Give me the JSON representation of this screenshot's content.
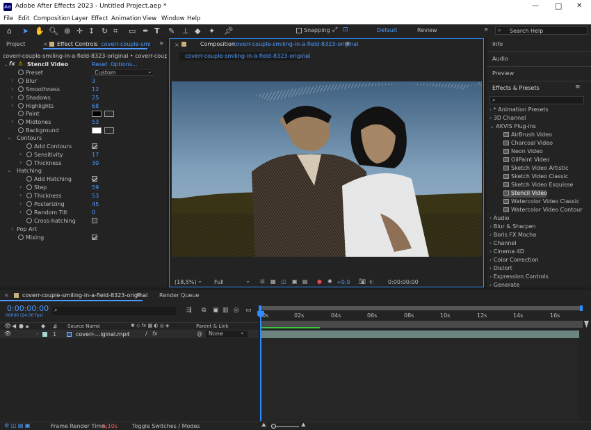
{
  "app": {
    "title": "Adobe After Effects 2023 - Untitled Project.aep *",
    "logo": "Ae",
    "colors": {
      "accent": "#4d9bff",
      "bg": "#1d1d1d",
      "panel": "#232323"
    }
  },
  "window_controls": {
    "minimize": "—",
    "maximize": "□",
    "close": "✕"
  },
  "menu": [
    "File",
    "Edit",
    "Composition",
    "Layer",
    "Effect",
    "Animation",
    "View",
    "Window",
    "Help"
  ],
  "toolbar": {
    "snapping_label": "Snapping",
    "workspace_default": "Default",
    "workspace_review": "Review",
    "search_placeholder": "Search Help"
  },
  "left_panel": {
    "tab_project": "Project",
    "tab_effect_controls": "Effect Controls",
    "tab_effect_target": "coverr-couple-smi",
    "breadcrumb": "coverr-couple-smiling-in-a-field-8323-original  •  coverr-couple-smiling-i",
    "effect_name": "Stencil Video",
    "reset": "Reset",
    "options": "Options...",
    "preset_label": "Preset",
    "preset_value": "Custom",
    "params": [
      {
        "label": "Blur",
        "value": "3"
      },
      {
        "label": "Smoothness",
        "value": "12"
      },
      {
        "label": "Shadows",
        "value": "25"
      },
      {
        "label": "Highlights",
        "value": "68"
      },
      {
        "label": "Paint",
        "value": ""
      },
      {
        "label": "Midtones",
        "value": "53"
      },
      {
        "label": "Background",
        "value": ""
      }
    ],
    "contours_group": "Contours",
    "contours": [
      {
        "label": "Add Contours",
        "value": ""
      },
      {
        "label": "Sensitivity",
        "value": "17"
      },
      {
        "label": "Thickness",
        "value": "30"
      }
    ],
    "hatching_group": "Hatching",
    "hatching": [
      {
        "label": "Add Hatching",
        "value": ""
      },
      {
        "label": "Step",
        "value": "59"
      },
      {
        "label": "Thickness",
        "value": "53"
      },
      {
        "label": "Posterizing",
        "value": "45"
      },
      {
        "label": "Random Tilt",
        "value": "0"
      },
      {
        "label": "Cross-hatching",
        "value": ""
      }
    ],
    "popart_group": "Pop Art",
    "mixing_label": "Mixing"
  },
  "composition": {
    "tab_label": "Composition",
    "tab_name": "coverr-couple-smiling-in-a-field-8323-original",
    "subtab": "coverr-couple-smiling-in-a-field-8323-original",
    "zoom": "(18,5%)",
    "resolution": "Full",
    "exposure": "+0,0",
    "timecode": "0:00:00:00"
  },
  "right_panel": {
    "info": "Info",
    "audio": "Audio",
    "preview": "Preview",
    "effects_presets": "Effects & Presets",
    "tree": [
      {
        "label": "* Animation Presets",
        "level": 0,
        "open": false
      },
      {
        "label": "3D Channel",
        "level": 0,
        "open": false
      },
      {
        "label": "AKVIS Plug-ins",
        "level": 0,
        "open": true
      },
      {
        "label": "AirBrush Video",
        "level": 1
      },
      {
        "label": "Charcoal Video",
        "level": 1
      },
      {
        "label": "Neon Video",
        "level": 1
      },
      {
        "label": "OilPaint Video",
        "level": 1
      },
      {
        "label": "Sketch Video Artistic",
        "level": 1
      },
      {
        "label": "Sketch Video Classic",
        "level": 1
      },
      {
        "label": "Sketch Video Esquisse",
        "level": 1
      },
      {
        "label": "Stencil Video",
        "level": 1,
        "selected": true
      },
      {
        "label": "Watercolor Video Classic",
        "level": 1
      },
      {
        "label": "Watercolor Video Contour",
        "level": 1
      },
      {
        "label": "Audio",
        "level": 0,
        "open": false
      },
      {
        "label": "Blur & Sharpen",
        "level": 0,
        "open": false
      },
      {
        "label": "Boris FX Mocha",
        "level": 0,
        "open": false
      },
      {
        "label": "Channel",
        "level": 0,
        "open": false
      },
      {
        "label": "Cinema 4D",
        "level": 0,
        "open": false
      },
      {
        "label": "Color Correction",
        "level": 0,
        "open": false
      },
      {
        "label": "Distort",
        "level": 0,
        "open": false
      },
      {
        "label": "Expression Controls",
        "level": 0,
        "open": false
      },
      {
        "label": "Generate",
        "level": 0,
        "open": false
      }
    ]
  },
  "timeline": {
    "tab_name": "coverr-couple-smiling-in-a-field-8323-original",
    "render_queue": "Render Queue",
    "timecode": "0:00:00:00",
    "fps": "00000 (24.00 fps)",
    "col_number": "#",
    "col_source": "Source Name",
    "col_parent": "Parent & Link",
    "layer_number": "1",
    "layer_name": "coverr-...iginal.mp4",
    "layer_parent": "None",
    "ruler": [
      "00s",
      "02s",
      "04s",
      "06s",
      "08s",
      "10s",
      "12s",
      "14s",
      "16s"
    ],
    "frame_render_label": "Frame Render Time:",
    "frame_render_value": "5,10s",
    "toggle_label": "Toggle Switches / Modes"
  }
}
